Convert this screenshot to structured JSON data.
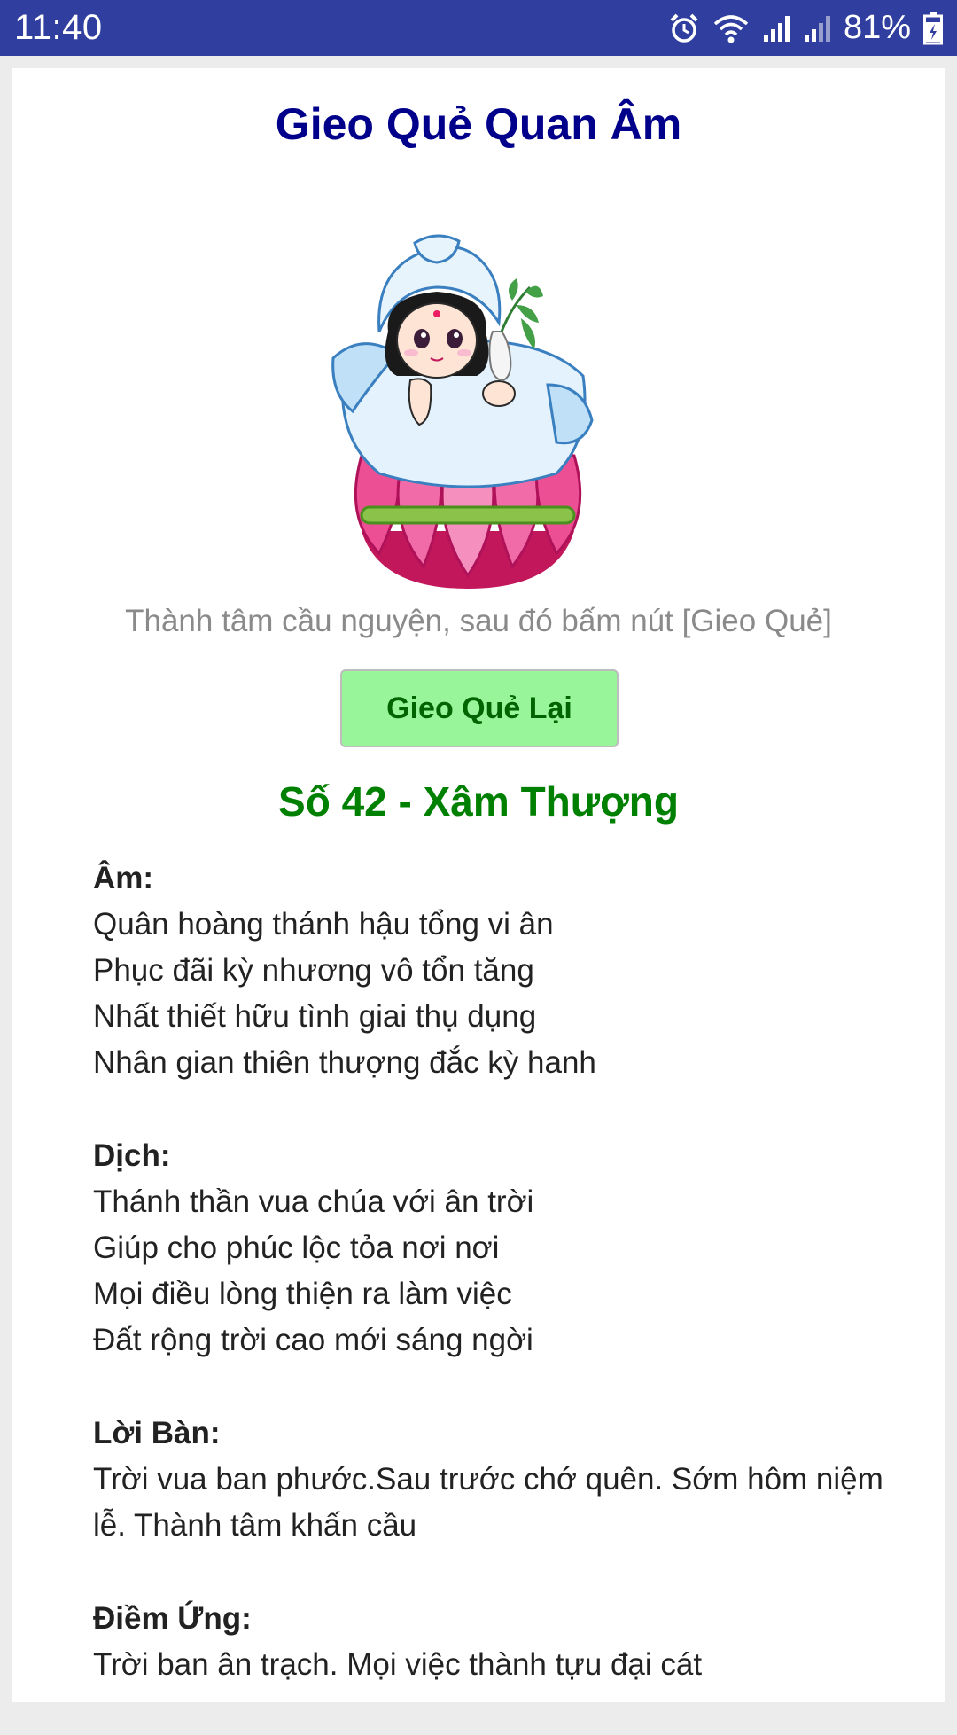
{
  "status_bar": {
    "time": "11:40",
    "battery": "81%",
    "icons": [
      "alarm-icon",
      "wifi-icon",
      "signal-icon",
      "signal-icon",
      "battery-charging-icon"
    ]
  },
  "app": {
    "title": "Gieo Quẻ Quan Âm",
    "instruction": "Thành tâm cầu nguyện, sau đó bấm nút [Gieo Quẻ]",
    "button_label": "Gieo Quẻ Lại",
    "result_title": "Số 42 - Xâm Thượng"
  },
  "sections": [
    {
      "heading": "Âm:",
      "lines": [
        "Quân hoàng thánh hậu tổng vi ân",
        "Phục đãi kỳ nhương vô tổn tăng",
        "Nhất thiết hữu tình giai thụ dụng",
        "Nhân gian thiên thượng đắc kỳ hanh"
      ]
    },
    {
      "heading": "Dịch:",
      "lines": [
        "Thánh thần vua chúa với ân trời",
        "Giúp cho phúc lộc tỏa nơi nơi",
        "Mọi điều lòng thiện ra làm việc",
        "Đất rộng trời cao mới sáng ngời"
      ]
    },
    {
      "heading": "Lời Bàn:",
      "lines": [
        "Trời vua ban phước.Sau trước chớ quên. Sớm hôm niệm lễ. Thành tâm khấn cầu"
      ]
    },
    {
      "heading": "Điềm Ứng:",
      "lines": [
        "Trời ban ân trạch. Mọi việc thành tựu đại cát"
      ]
    }
  ],
  "colors": {
    "status_bar": "#303f9f",
    "title": "#00008b",
    "result": "#008000",
    "button_bg": "#98f59a",
    "button_text": "#006400"
  }
}
